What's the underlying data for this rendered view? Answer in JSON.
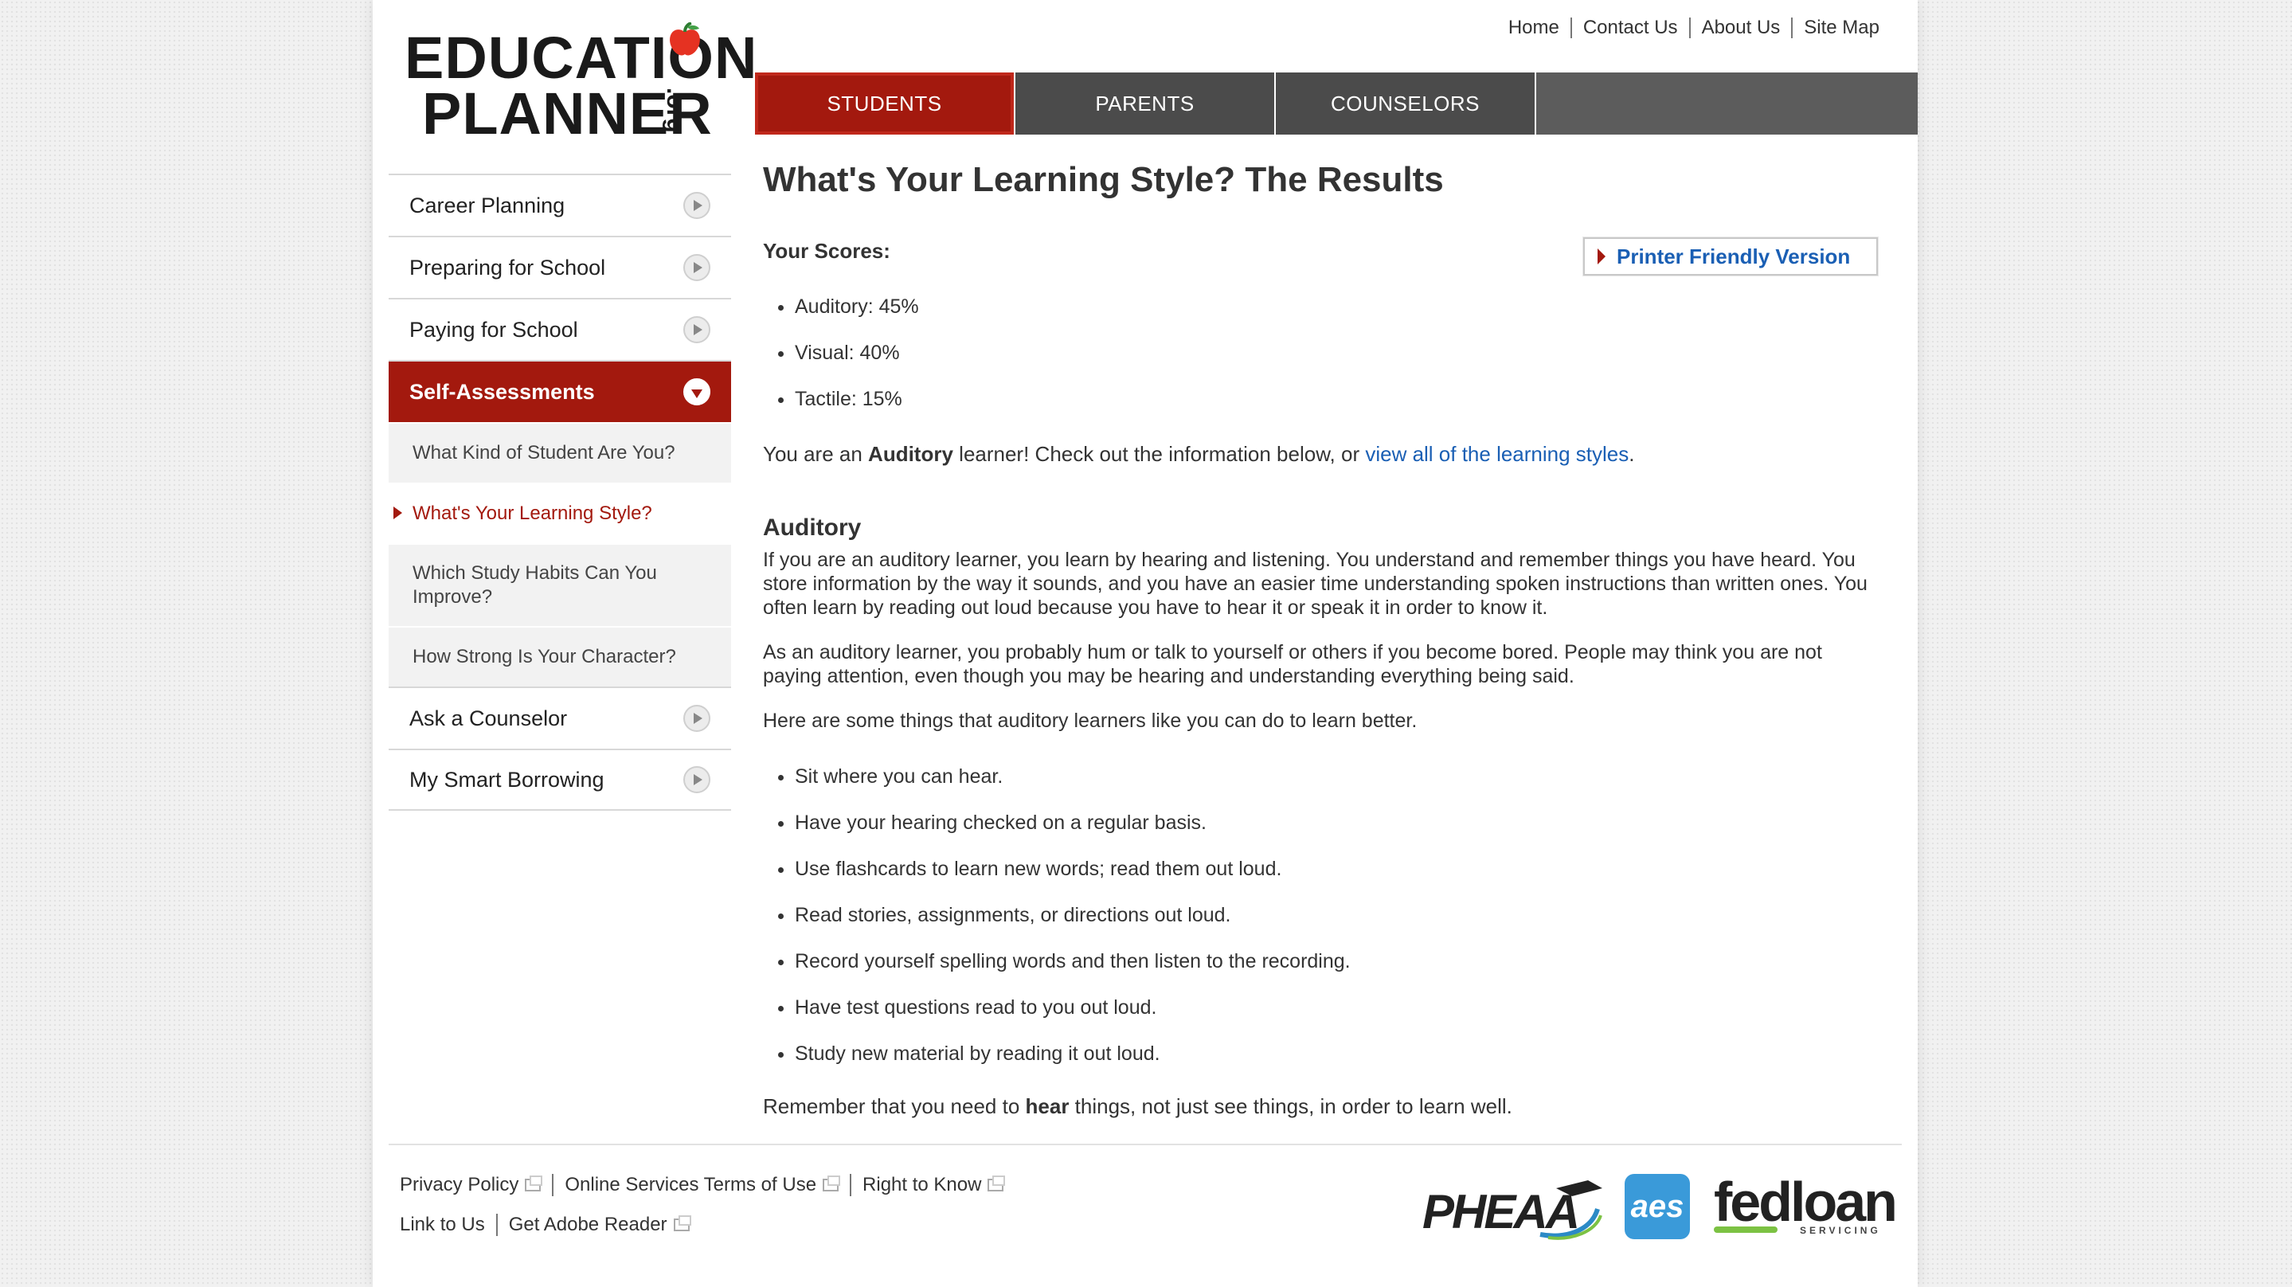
{
  "logo": {
    "line1": "EDUCATION",
    "line2": "PLANNER",
    "suffix": ".org"
  },
  "util_nav": [
    "Home",
    "Contact Us",
    "About Us",
    "Site Map"
  ],
  "tabs": [
    {
      "label": "STUDENTS",
      "active": true
    },
    {
      "label": "PARENTS",
      "active": false
    },
    {
      "label": "COUNSELORS",
      "active": false
    }
  ],
  "sidebar": {
    "items": [
      {
        "label": "Career Planning"
      },
      {
        "label": "Preparing for School"
      },
      {
        "label": "Paying for School"
      },
      {
        "label": "Self-Assessments"
      }
    ],
    "sub_items": [
      {
        "label": "What Kind of Student Are You?"
      },
      {
        "label": "What's Your Learning Style?"
      },
      {
        "label": "Which Study Habits Can You Improve?"
      },
      {
        "label": "How Strong Is Your Character?"
      }
    ],
    "bottom_items": [
      {
        "label": "Ask a Counselor"
      },
      {
        "label": "My Smart Borrowing"
      }
    ]
  },
  "main": {
    "title": "What's Your Learning Style? The Results",
    "scores_label": "Your Scores:",
    "printer_label": "Printer Friendly Version",
    "scores": [
      "Auditory: 45%",
      "Visual: 40%",
      "Tactile: 15%"
    ],
    "summary_pre": "You are an ",
    "summary_bold": "Auditory",
    "summary_mid": " learner! Check out the information below, or ",
    "summary_link": "view all of the learning styles",
    "summary_post": ".",
    "section_heading": "Auditory",
    "para1": "If you are an auditory learner, you learn by hearing and listening. You understand and remember things you have heard. You store information by the way it sounds, and you have an easier time understanding spoken instructions than written ones. You often learn by reading out loud because you have to hear it or speak it in order to know it.",
    "para2": "As an auditory learner, you probably hum or talk to yourself or others if you become bored. People may think you are not paying attention, even though you may be hearing and understanding everything being said.",
    "para3": "Here are some things that auditory learners like you can do to learn better.",
    "tips": [
      "Sit where you can hear.",
      "Have your hearing checked on a regular basis.",
      "Use flashcards to learn new words; read them out loud.",
      "Read stories, assignments, or directions out loud.",
      "Record yourself spelling words and then listen to the recording.",
      "Have test questions read to you out loud.",
      "Study new material by reading it out loud."
    ],
    "closing_pre": "Remember that you need to ",
    "closing_bold": "hear",
    "closing_post": " things, not just see things, in order to learn well."
  },
  "footer": {
    "row1": [
      "Privacy Policy",
      "Online Services Terms of Use",
      "Right to Know"
    ],
    "row2": [
      "Link to Us",
      "Get Adobe Reader"
    ]
  },
  "partners": {
    "pheaa": "PHEAA",
    "aes": "aes",
    "fedloan": "fedloan",
    "fedloan_sub": "SERVICING"
  },
  "colors": {
    "brand_red": "#a3190e",
    "link_blue": "#1a5fb4",
    "tab_gray": "#4b4b4b"
  }
}
